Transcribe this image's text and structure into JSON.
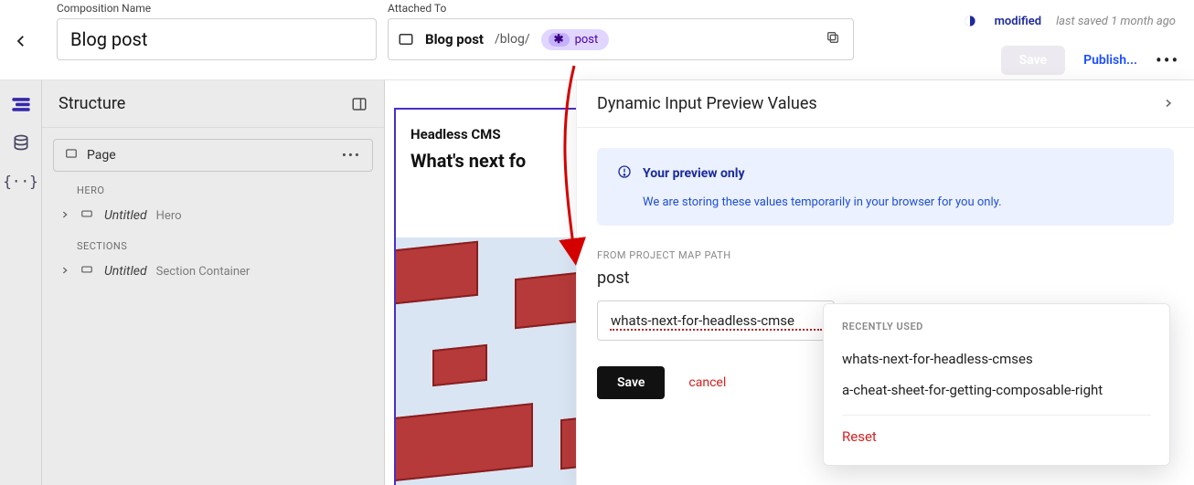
{
  "header": {
    "comp_label": "Composition Name",
    "comp_value": "Blog post",
    "attached_label": "Attached To",
    "attached_name": "Blog post",
    "attached_path": "/blog/",
    "attached_chip": "post",
    "modified": "modified",
    "last_saved": "last saved 1 month ago",
    "save": "Save",
    "publish": "Publish..."
  },
  "structure": {
    "title": "Structure",
    "page": "Page",
    "section_hero": "HERO",
    "section_sections": "SECTIONS",
    "nodes": [
      {
        "name": "Untitled",
        "subtype": "Hero"
      },
      {
        "name": "Untitled",
        "subtype": "Section Container"
      }
    ]
  },
  "preview": {
    "category": "Headless CMS",
    "title": "What's next fo"
  },
  "panel": {
    "title": "Dynamic Input Preview Values",
    "info_heading": "Your preview only",
    "info_body": "We are storing these values temporarily in your browser for you only.",
    "field_label": "FROM PROJECT MAP PATH",
    "post_name": "post",
    "slug_value": "whats-next-for-headless-cmse",
    "save": "Save",
    "cancel": "cancel"
  },
  "popover": {
    "label": "RECENTLY USED",
    "items": [
      "whats-next-for-headless-cmses",
      "a-cheat-sheet-for-getting-composable-right"
    ],
    "reset": "Reset"
  }
}
